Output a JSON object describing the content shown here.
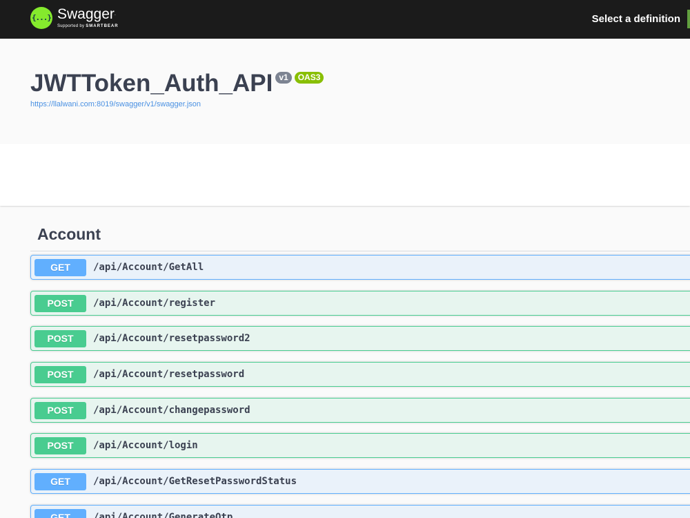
{
  "topbar": {
    "logo_icon_text": "{...}",
    "logo_name": "Swagger",
    "logo_tm": ".",
    "logo_supported_by": "Supported by",
    "logo_company": "SMARTBEAR",
    "select_definition_label": "Select a definition",
    "colors": {
      "background": "#1b1b1b",
      "logo": "#85ea2d",
      "select_accent": "#62a03f"
    }
  },
  "info": {
    "title": "JWTToken_Auth_API",
    "version_badge": "v1",
    "oas_badge": "OAS3",
    "spec_url": "https://llalwani.com:8019/swagger/v1/swagger.json"
  },
  "tag": {
    "name": "Account",
    "operations": [
      {
        "method": "GET",
        "path": "/api/Account/GetAll"
      },
      {
        "method": "POST",
        "path": "/api/Account/register"
      },
      {
        "method": "POST",
        "path": "/api/Account/resetpassword2"
      },
      {
        "method": "POST",
        "path": "/api/Account/resetpassword"
      },
      {
        "method": "POST",
        "path": "/api/Account/changepassword"
      },
      {
        "method": "POST",
        "path": "/api/Account/login"
      },
      {
        "method": "GET",
        "path": "/api/Account/GetResetPasswordStatus"
      },
      {
        "method": "GET",
        "path": "/api/Account/GenerateOtp"
      }
    ]
  },
  "colors": {
    "get": "#61affe",
    "post": "#49cc90",
    "version_badge": "#7d8492",
    "oas_badge": "#89bf04",
    "link": "#4990e2"
  }
}
